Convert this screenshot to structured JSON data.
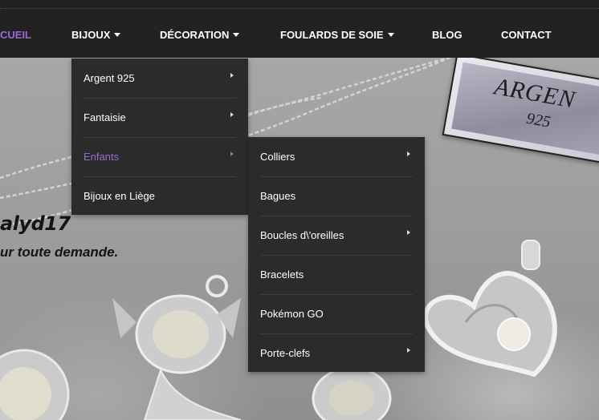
{
  "nav": {
    "items": [
      {
        "label": "CUEIL",
        "active": true,
        "has_dropdown": false
      },
      {
        "label": "BIJOUX",
        "active": false,
        "has_dropdown": true
      },
      {
        "label": "DÉCORATION",
        "active": false,
        "has_dropdown": true
      },
      {
        "label": "FOULARDS DE SOIE",
        "active": false,
        "has_dropdown": true
      },
      {
        "label": "BLOG",
        "active": false,
        "has_dropdown": false
      },
      {
        "label": "CONTACT",
        "active": false,
        "has_dropdown": false
      }
    ],
    "active_color": "#9a6ad3",
    "background": "#222222"
  },
  "bijoux_menu": {
    "items": [
      {
        "label": "Argent 925",
        "has_submenu": true,
        "active": false
      },
      {
        "label": "Fantaisie",
        "has_submenu": true,
        "active": false
      },
      {
        "label": "Enfants",
        "has_submenu": true,
        "active": true
      },
      {
        "label": "Bijoux en Liège",
        "has_submenu": false,
        "active": false
      }
    ]
  },
  "enfants_menu": {
    "items": [
      {
        "label": "Colliers",
        "has_submenu": true
      },
      {
        "label": "Bagues",
        "has_submenu": false
      },
      {
        "label": "Boucles d\\'oreilles",
        "has_submenu": true
      },
      {
        "label": "Bracelets",
        "has_submenu": false
      },
      {
        "label": "Pokémon GO",
        "has_submenu": false
      },
      {
        "label": "Porte-clefs",
        "has_submenu": true
      }
    ]
  },
  "hero": {
    "title": "alyd17",
    "subtitle": "ur toute demande.",
    "tag_text": "ARGEN",
    "tag_number": "925"
  }
}
